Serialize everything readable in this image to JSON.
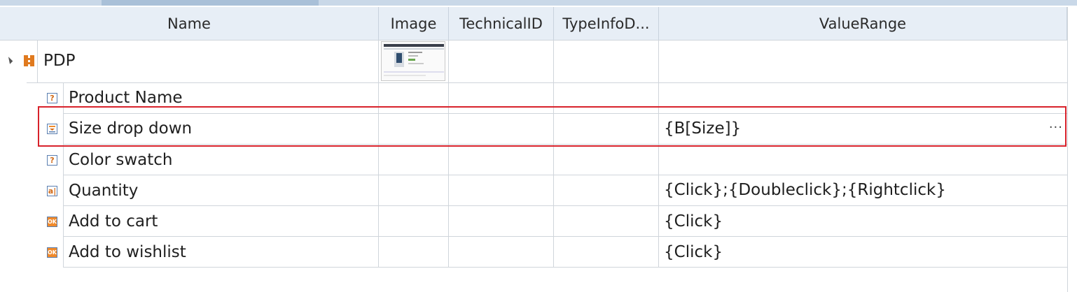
{
  "columns": [
    {
      "key": "name",
      "label": "Name"
    },
    {
      "key": "image",
      "label": "Image"
    },
    {
      "key": "technical_id",
      "label": "TechnicalID"
    },
    {
      "key": "typeinfo",
      "label": "TypeInfoD..."
    },
    {
      "key": "value_range",
      "label": "ValueRange"
    }
  ],
  "root": {
    "name": "PDP",
    "icon": "puzzle-icon",
    "expander_icon": "expand-triangle-icon",
    "has_image": true
  },
  "rows": [
    {
      "name": "Product Name",
      "icon": "question-icon",
      "value_range": ""
    },
    {
      "name": "Size drop down",
      "icon": "dropdown-icon",
      "value_range": "{B[Size]}",
      "selected": true,
      "more": "···"
    },
    {
      "name": "Color swatch",
      "icon": "question-icon",
      "value_range": ""
    },
    {
      "name": "Quantity",
      "icon": "textbox-icon",
      "value_range": "{Click};{Doubleclick};{Rightclick}"
    },
    {
      "name": "Add to cart",
      "icon": "ok-button-icon",
      "value_range": "{Click}"
    },
    {
      "name": "Add to wishlist",
      "icon": "ok-button-icon",
      "value_range": "{Click}"
    }
  ],
  "colors": {
    "header_bg": "#e7eef6",
    "highlight": "#d8222b",
    "icon_orange": "#d26a18"
  }
}
